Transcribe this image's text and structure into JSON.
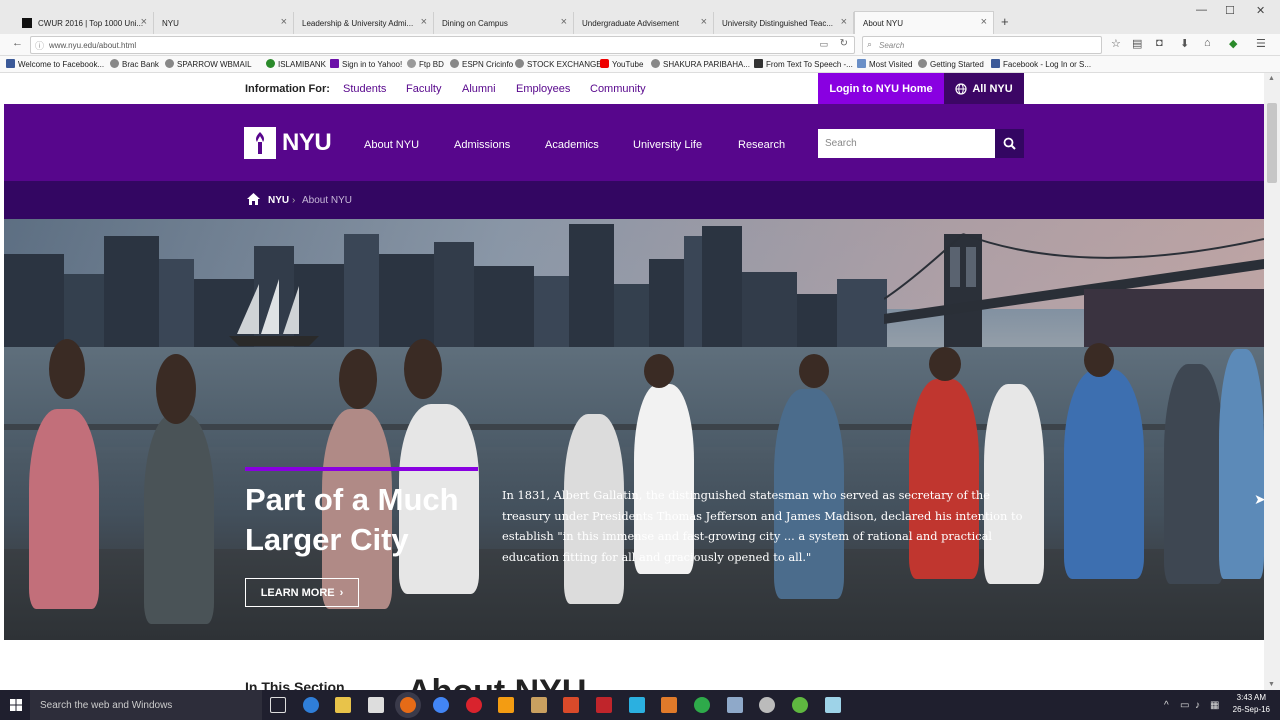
{
  "browser": {
    "tabs": [
      {
        "label": "CWUR 2016 | Top 1000 Uni..."
      },
      {
        "label": "NYU"
      },
      {
        "label": "Leadership & University Admi..."
      },
      {
        "label": "Dining on Campus"
      },
      {
        "label": "Undergraduate Advisement"
      },
      {
        "label": "University Distinguished Teac..."
      },
      {
        "label": "About NYU"
      }
    ],
    "url": "www.nyu.edu/about.html",
    "search_placeholder": "Search",
    "bookmarks": [
      "Welcome to Facebook...",
      "Brac Bank",
      "SPARROW WBMAIL",
      "ISLAMIBANK",
      "Sign in to Yahoo!",
      "Ftp BD",
      "ESPN Cricinfo",
      "STOCK EXCHANGE",
      "YouTube",
      "SHAKURA PARIBAHA...",
      "From Text To Speech -...",
      "Most Visited",
      "Getting Started",
      "Facebook - Log In or S..."
    ]
  },
  "page": {
    "info_for_label": "Information For:",
    "info_links": [
      "Students",
      "Faculty",
      "Alumni",
      "Employees",
      "Community"
    ],
    "login_label": "Login to NYU Home",
    "all_nyu_label": "All NYU",
    "logo_text": "NYU",
    "main_nav": [
      "About NYU",
      "Admissions",
      "Academics",
      "University Life",
      "Research"
    ],
    "site_search_placeholder": "Search",
    "breadcrumb": {
      "home": "NYU",
      "current": "About NYU"
    },
    "hero": {
      "title": "Part of a Much Larger City",
      "text": "In 1831, Albert Gallatin, the distinguished statesman who served as secretary of the treasury under Presidents Thomas Jefferson and James Madison, declared his intention to establish \"in this immense and fast-growing city ... a system of rational and practical education fitting for all and graciously opened to all.\"",
      "button": "LEARN MORE"
    },
    "section_label": "In This Section",
    "section_heading": "About NYU"
  },
  "taskbar": {
    "search_placeholder": "Search the web and Windows",
    "time": "3:43 AM",
    "date": "26-Sep-16"
  },
  "colors": {
    "nyu_purple": "#57068c",
    "nyu_dark_purple": "#330662",
    "nyu_bright_purple": "#8900e1"
  }
}
